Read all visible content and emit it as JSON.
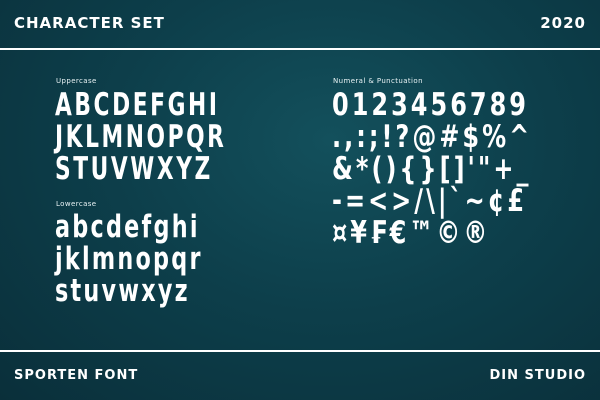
{
  "header": {
    "title": "CHARACTER SET",
    "year": "2020"
  },
  "uppercase": {
    "label": "Uppercase",
    "rows": [
      "ABCDEFGHI",
      "JKLMNOPQR",
      "STUVWXYZ"
    ]
  },
  "lowercase": {
    "label": "Lowercase",
    "rows": [
      "abcdefghi",
      "jklmnopqr",
      "stuvwxyz"
    ]
  },
  "numeral_punctuation": {
    "label": "Numeral & Punctuation",
    "rows": [
      "0123456789",
      ".,:;!?@#$%^",
      "&*(){}[]'\"+_",
      "-=<>/\\|`~¢£",
      "¤¥₣€™©®"
    ]
  },
  "footer": {
    "font_name": "SPORTEN FONT",
    "studio": "DIN STUDIO"
  },
  "colors": {
    "background": "#0d3f4b",
    "foreground": "#ffffff"
  }
}
